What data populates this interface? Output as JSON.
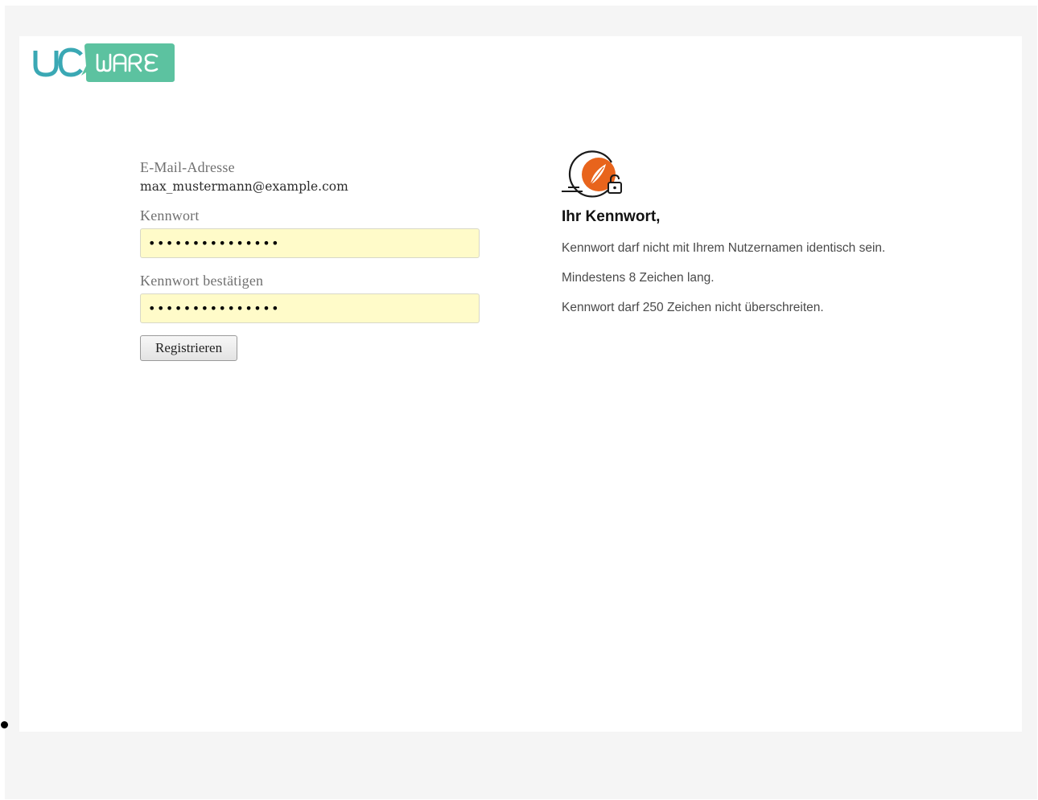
{
  "logo": {
    "left_text": "UC",
    "right_text": "WARE",
    "colors": {
      "uc": "#3aa8b4",
      "badge": "#5cc2a0"
    }
  },
  "form": {
    "email_label": "E-Mail-Adresse",
    "email_value": "max_mustermann@example.com",
    "password_label": "Kennwort",
    "password_value": "•••••••••••••••",
    "confirm_label": "Kennwort bestätigen",
    "confirm_value": "•••••••••••••••",
    "submit_label": "Registrieren"
  },
  "info": {
    "icon": "password-lock-icon",
    "title": "Ihr Kennwort,",
    "rules": [
      "Kennwort darf nicht mit Ihrem Nutzernamen identisch sein.",
      "Mindestens 8 Zeichen lang.",
      "Kennwort darf 250 Zeichen nicht überschreiten."
    ],
    "accent_color": "#e8641c"
  }
}
